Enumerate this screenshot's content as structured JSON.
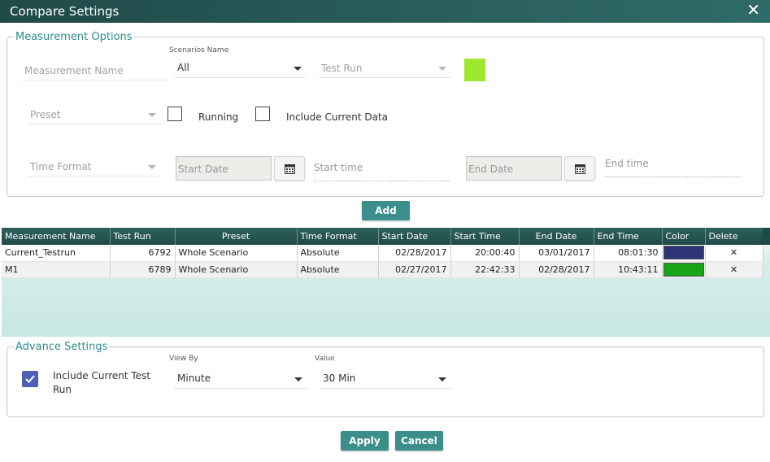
{
  "window": {
    "title": "Compare Settings"
  },
  "measurement_options": {
    "legend": "Measurement Options",
    "measurement_name_placeholder": "Measurement Name",
    "scenarios_label": "Scenarios Name",
    "scenarios_value": "All",
    "test_run_placeholder": "Test Run",
    "swatch_color": "#9ee82f",
    "preset_placeholder": "Preset",
    "running_label": "Running",
    "include_current_label": "Include Current Data",
    "time_format_placeholder": "Time Format",
    "start_date_placeholder": "Start Date",
    "start_time_placeholder": "Start time",
    "end_date_placeholder": "End Date",
    "end_time_placeholder": "End time",
    "add_label": "Add"
  },
  "table": {
    "columns": [
      "Measurement Name",
      "Test Run",
      "Preset",
      "Time Format",
      "Start Date",
      "Start Time",
      "End Date",
      "End Time",
      "Color",
      "Delete"
    ],
    "rows": [
      {
        "name": "Current_Testrun",
        "test_run": "6792",
        "preset": "Whole Scenario",
        "time_format": "Absolute",
        "start_date": "02/28/2017",
        "start_time": "20:00:40",
        "end_date": "03/01/2017",
        "end_time": "08:01:30",
        "color": "#2e3577"
      },
      {
        "name": "M1",
        "test_run": "6789",
        "preset": "Whole Scenario",
        "time_format": "Absolute",
        "start_date": "02/27/2017",
        "start_time": "22:42:33",
        "end_date": "02/28/2017",
        "end_time": "10:43:11",
        "color": "#17a417"
      }
    ]
  },
  "advance_settings": {
    "legend": "Advance Settings",
    "include_current_line1": "Include Current Test",
    "include_current_line2": "Run",
    "view_by_label": "View By",
    "view_by_value": "Minute",
    "value_label": "Value",
    "value_value": "30 Min"
  },
  "footer": {
    "apply_label": "Apply",
    "cancel_label": "Cancel"
  }
}
